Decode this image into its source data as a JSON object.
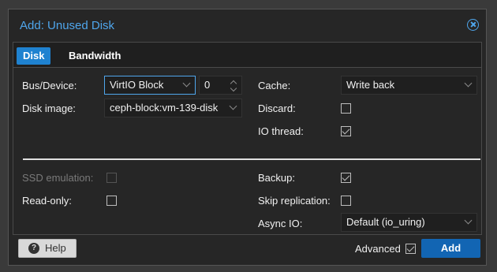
{
  "dialog": {
    "title": "Add: Unused Disk"
  },
  "tabs": [
    {
      "label": "Disk",
      "active": true
    },
    {
      "label": "Bandwidth",
      "active": false
    }
  ],
  "form": {
    "bus_device": {
      "label": "Bus/Device:",
      "bus_value": "VirtIO Block",
      "device_number": "0"
    },
    "disk_image": {
      "label": "Disk image:",
      "value": "ceph-block:vm-139-disk"
    },
    "cache": {
      "label": "Cache:",
      "value": "Write back"
    },
    "discard": {
      "label": "Discard:",
      "checked": false
    },
    "io_thread": {
      "label": "IO thread:",
      "checked": true
    },
    "ssd_emulation": {
      "label": "SSD emulation:",
      "checked": false,
      "disabled": true
    },
    "read_only": {
      "label": "Read-only:",
      "checked": false
    },
    "backup": {
      "label": "Backup:",
      "checked": true
    },
    "skip_replication": {
      "label": "Skip replication:",
      "checked": false
    },
    "async_io": {
      "label": "Async IO:",
      "value": "Default (io_uring)"
    }
  },
  "footer": {
    "help_label": "Help",
    "advanced_label": "Advanced",
    "advanced_checked": true,
    "add_label": "Add"
  },
  "colors": {
    "accent": "#1f82d0",
    "title": "#4fa6ec",
    "primary_button": "#1265b3"
  }
}
